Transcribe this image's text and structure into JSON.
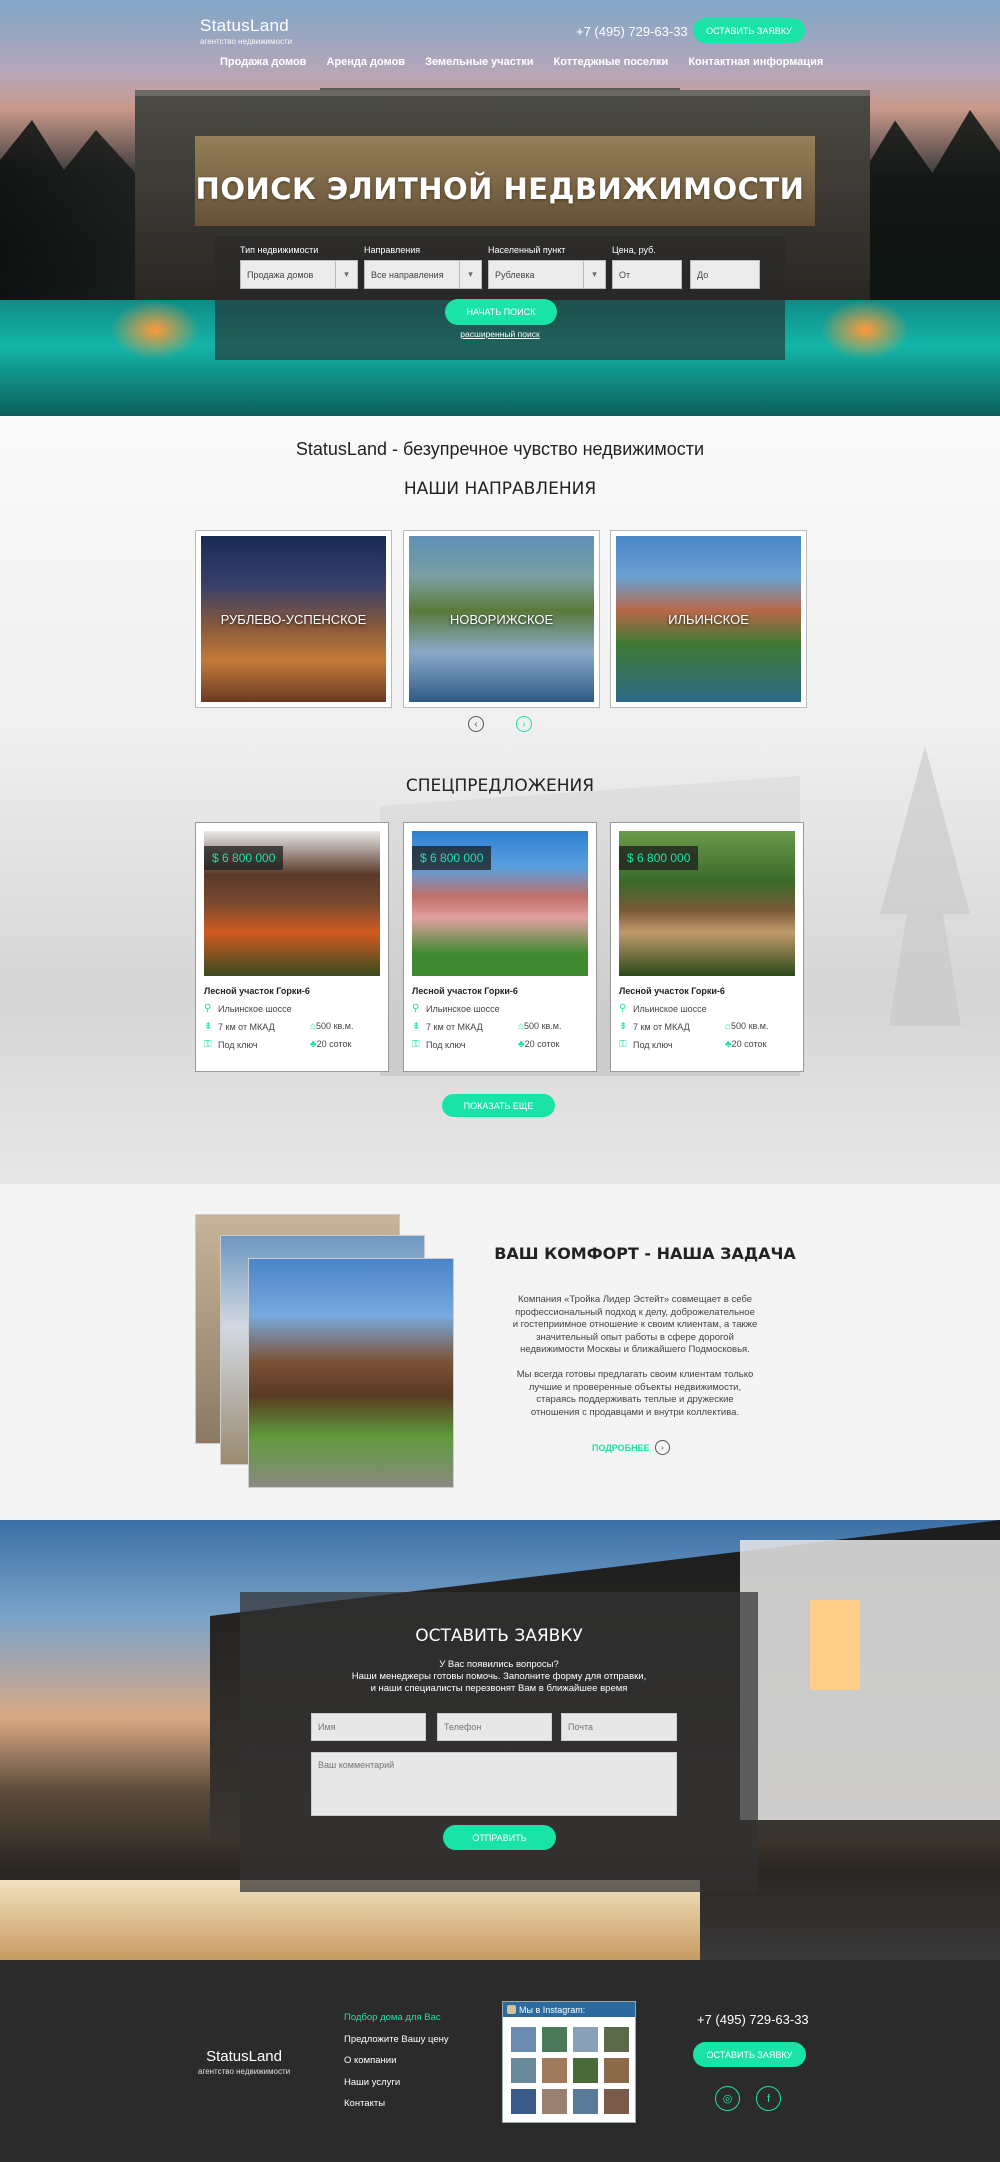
{
  "header": {
    "logo_title": "StatusLand",
    "logo_subtitle": "агентство недвижимости",
    "phone": "+7 (495) 729-63-33",
    "cta": "оставить заявку"
  },
  "nav": [
    "Продажа домов",
    "Аренда домов",
    "Земельные участки",
    "Коттеджные поселки",
    "Контактная информация"
  ],
  "hero": {
    "title": "ПОИСК ЭЛИТНОЙ НЕДВИЖИМОСТИ",
    "fields": {
      "type_label": "Тип недвижимости",
      "type_value": "Продажа домов",
      "dir_label": "Направления",
      "dir_value": "Все направления",
      "city_label": "Населенный пункт",
      "city_value": "Рублевка",
      "price_label": "Цена, руб.",
      "price_from": "От",
      "price_to": "До"
    },
    "search_btn": "начать поиск",
    "advanced": "расширенный поиск"
  },
  "tagline": "StatusLand - безупречное чувство недвижимости",
  "directions": {
    "title": "НАШИ НАПРАВЛЕНИЯ",
    "items": [
      "РУБЛЕВО-УСПЕНСКОЕ",
      "НОВОРИЖСКОЕ",
      "ИЛЬИНСКОЕ"
    ]
  },
  "specials": {
    "title": "СПЕЦПРЕДЛОЖЕНИЯ",
    "cards": [
      {
        "price": "$ 6 800 000",
        "name": "Лесной участок Горки-6",
        "road": "Ильинское шоссе",
        "distance": "7 км от МКАД",
        "area": "500 кв.м.",
        "key": "Под ключ",
        "plots": "20 соток"
      },
      {
        "price": "$ 6 800 000",
        "name": "Лесной участок Горки-6",
        "road": "Ильинское шоссе",
        "distance": "7 км от МКАД",
        "area": "500 кв.м.",
        "key": "Под ключ",
        "plots": "20 соток"
      },
      {
        "price": "$ 6 800 000",
        "name": "Лесной участок Горки-6",
        "road": "Ильинское шоссе",
        "distance": "7 км от МКАД",
        "area": "500 кв.м.",
        "key": "Под ключ",
        "plots": "20 соток"
      }
    ],
    "more_btn": "показать еще"
  },
  "comfort": {
    "title": "ВАШ КОМФОРТ - НАША ЗАДАЧА",
    "p1": [
      "Компания «Тройка Лидер Эстейт» совмещает в себе",
      "профессиональный подход к делу, доброжелательное",
      "и гостеприимное отношение к своим клиентам, а также",
      "значительный опыт работы в сфере дорогой",
      "недвижимости Москвы и ближайшего Подмосковья."
    ],
    "p2": [
      "Мы всегда готовы предлагать своим клиентам только",
      "лучшие и проверенные объекты недвижимости,",
      "стараясь поддерживать теплые и дружеские",
      "отношения с продавцами и внутри коллектива."
    ],
    "more": "ПОДРОБНЕЕ"
  },
  "request": {
    "title": "ОСТАВИТЬ ЗАЯВКУ",
    "lines": [
      "У Вас появились вопросы?",
      "Наши менеджеры готовы помочь. Заполните форму для отправки,",
      "и наши специалисты перезвонят Вам в ближайшее время"
    ],
    "name_ph": "Имя",
    "phone_ph": "Телефон",
    "mail_ph": "Почта",
    "comment_ph": "Ваш комментарий",
    "send": "отправить"
  },
  "footer": {
    "logo_title": "StatusLand",
    "logo_subtitle": "агентство недвижимости",
    "links": [
      "Подбор дома для Вас",
      "Предложите Вашу цену",
      "О компании",
      "Наши услуги",
      "Контакты"
    ],
    "active_color": "#19e3a6",
    "instagram_title": "Мы в Instagram:",
    "phone": "+7 (495) 729-63-33",
    "cta": "оставить заявку",
    "social_icons": [
      "instagram-icon",
      "facebook-icon"
    ]
  },
  "colors": {
    "accent": "#19e3a6",
    "footer_bg": "#2b2b2b"
  }
}
